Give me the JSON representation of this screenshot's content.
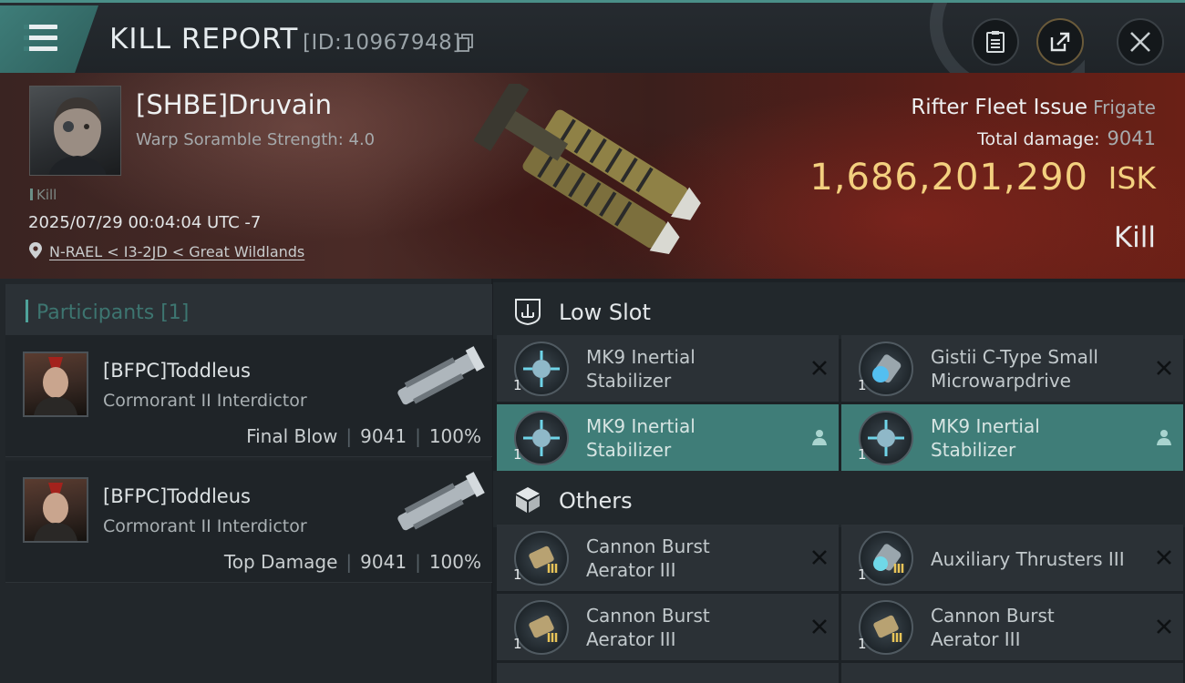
{
  "header": {
    "title": "KILL REPORT",
    "kill_id": "[ID:10967948]"
  },
  "victim": {
    "pilot": "[SHBE]Druvain",
    "scramble": "Warp Soramble Strength: 4.0",
    "tag": "Kill",
    "datetime": "2025/07/29 00:04:04 UTC -7",
    "location": "N-RAEL < I3-2JD < Great Wildlands",
    "ship": "Rifter Fleet Issue",
    "ship_class": "Frigate",
    "total_damage_label": "Total damage:",
    "total_damage": "9041",
    "isk_value": "1,686,201,290",
    "isk_unit": "ISK",
    "result": "Kill"
  },
  "participants": {
    "title": "Participants [1]",
    "list": [
      {
        "name": "[BFPC]Toddleus",
        "ship": "Cormorant II Interdictor",
        "role": "Final Blow",
        "damage": "9041",
        "percent": "100%"
      },
      {
        "name": "[BFPC]Toddleus",
        "ship": "Cormorant II Interdictor",
        "role": "Top Damage",
        "damage": "9041",
        "percent": "100%"
      }
    ]
  },
  "fitting": {
    "low_slot": {
      "title": "Low Slot",
      "items": [
        {
          "line1": "MK9 Inertial",
          "line2": "Stabilizer",
          "qty": "1",
          "state": "destroyed"
        },
        {
          "line1": "Gistii C-Type Small",
          "line2": "Microwarpdrive",
          "qty": "1",
          "state": "destroyed"
        },
        {
          "line1": "MK9 Inertial",
          "line2": "Stabilizer",
          "qty": "1",
          "state": "dropped"
        },
        {
          "line1": "MK9 Inertial",
          "line2": "Stabilizer",
          "qty": "1",
          "state": "dropped"
        }
      ]
    },
    "others": {
      "title": "Others",
      "items": [
        {
          "line1": "Cannon Burst",
          "line2": "Aerator III",
          "qty": "1",
          "state": "destroyed"
        },
        {
          "line1": "Auxiliary Thrusters III",
          "line2": "",
          "qty": "1",
          "state": "destroyed"
        },
        {
          "line1": "Cannon Burst",
          "line2": "Aerator III",
          "qty": "1",
          "state": "destroyed"
        },
        {
          "line1": "Cannon Burst",
          "line2": "Aerator III",
          "qty": "1",
          "state": "destroyed"
        }
      ]
    }
  },
  "colors": {
    "accent": "#3f7d78",
    "isk_gold": "#f3d07f",
    "panel": "#2b3136"
  }
}
